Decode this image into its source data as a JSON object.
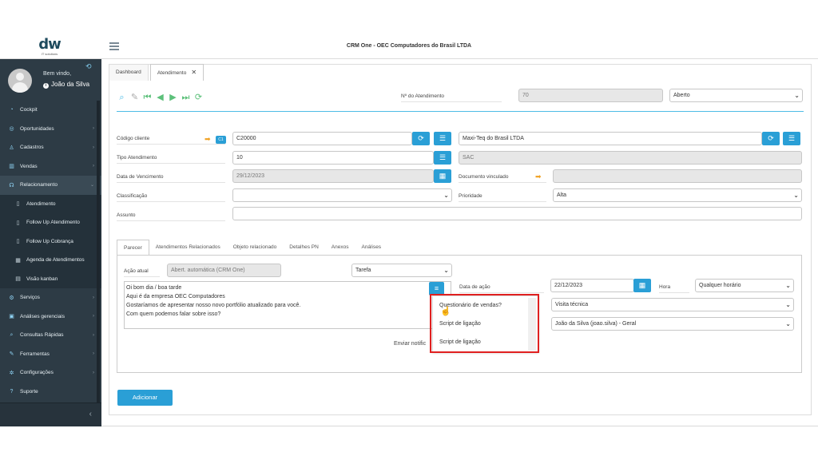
{
  "app": {
    "title": "CRM One - OEC Computadores do Brasil LTDA",
    "logo_text": "dw",
    "logo_sub": "IT solutions"
  },
  "user": {
    "welcome": "Bem vindo,",
    "name": "João da Silva"
  },
  "sidebar": {
    "items": [
      {
        "label": "Cockpit",
        "icon": "gauge-icon"
      },
      {
        "label": "Oportunidades",
        "icon": "target-icon"
      },
      {
        "label": "Cadastros",
        "icon": "user-icon"
      },
      {
        "label": "Vendas",
        "icon": "bar-chart-icon"
      },
      {
        "label": "Relacionamento",
        "icon": "headset-icon"
      },
      {
        "label": "Atendimento",
        "icon": "file-icon"
      },
      {
        "label": "Follow Up Atendimento",
        "icon": "file-icon"
      },
      {
        "label": "Follow Up Cobrança",
        "icon": "file-icon"
      },
      {
        "label": "Agenda de Atendimentos",
        "icon": "calendar-icon"
      },
      {
        "label": "Visão kanban",
        "icon": "columns-icon"
      },
      {
        "label": "Serviços",
        "icon": "gear-icon"
      },
      {
        "label": "Análises gerenciais",
        "icon": "book-icon"
      },
      {
        "label": "Consultas Rápidas",
        "icon": "search-icon"
      },
      {
        "label": "Ferramentas",
        "icon": "wrench-icon"
      },
      {
        "label": "Configurações",
        "icon": "cog-icon"
      },
      {
        "label": "Suporte",
        "icon": "help-icon"
      }
    ]
  },
  "tabs": {
    "dashboard": "Dashboard",
    "atendimento": "Atendimento"
  },
  "form": {
    "numero_label": "Nº do Atendimento",
    "numero_value": "70",
    "status_value": "Aberto",
    "codigo_cliente_label": "Código cliente",
    "c1_badge": "C1",
    "codigo_cliente_value": "C20000",
    "cliente_nome": "Maxi-Teq do Brasil LTDA",
    "tipo_label": "Tipo Atendimento",
    "tipo_value": "10",
    "tipo_desc": "SAC",
    "vencimento_label": "Data de Vencimento",
    "vencimento_value": "29/12/2023",
    "doc_vinculado_label": "Documento vinculado",
    "classificacao_label": "Classificação",
    "prioridade_label": "Prioridade",
    "prioridade_value": "Alta",
    "assunto_label": "Assunto"
  },
  "subtabs": [
    "Parecer",
    "Atendimentos Relacionados",
    "Objeto relacionado",
    "Detalhes PN",
    "Anexos",
    "Análises"
  ],
  "parecer": {
    "acao_label": "Ação atual",
    "acao_value": "Abert. automática (CRM One)",
    "tipo_value": "Tarefa",
    "text_lines": [
      "Oi bom dia / boa tarde",
      "Aqui é da empresa OEC Computadores",
      "Gostaríamos de apresentar nosso novo portfólio atualizado para você.",
      "Com quem podemos falar sobre isso?"
    ],
    "data_acao_label": "Data de ação",
    "data_acao_value": "22/12/2023",
    "hora_label": "Hora",
    "hora_value": "Qualquer horário",
    "atividade_value": "Visita técnica",
    "responsavel_value": "João da Silva (joao.silva) - Geral",
    "enviar_label": "Enviar notific"
  },
  "dropdown": {
    "options": [
      "Questionário de vendas?",
      "Script de ligação",
      "Script de ligação"
    ]
  },
  "buttons": {
    "adicionar": "Adicionar"
  }
}
